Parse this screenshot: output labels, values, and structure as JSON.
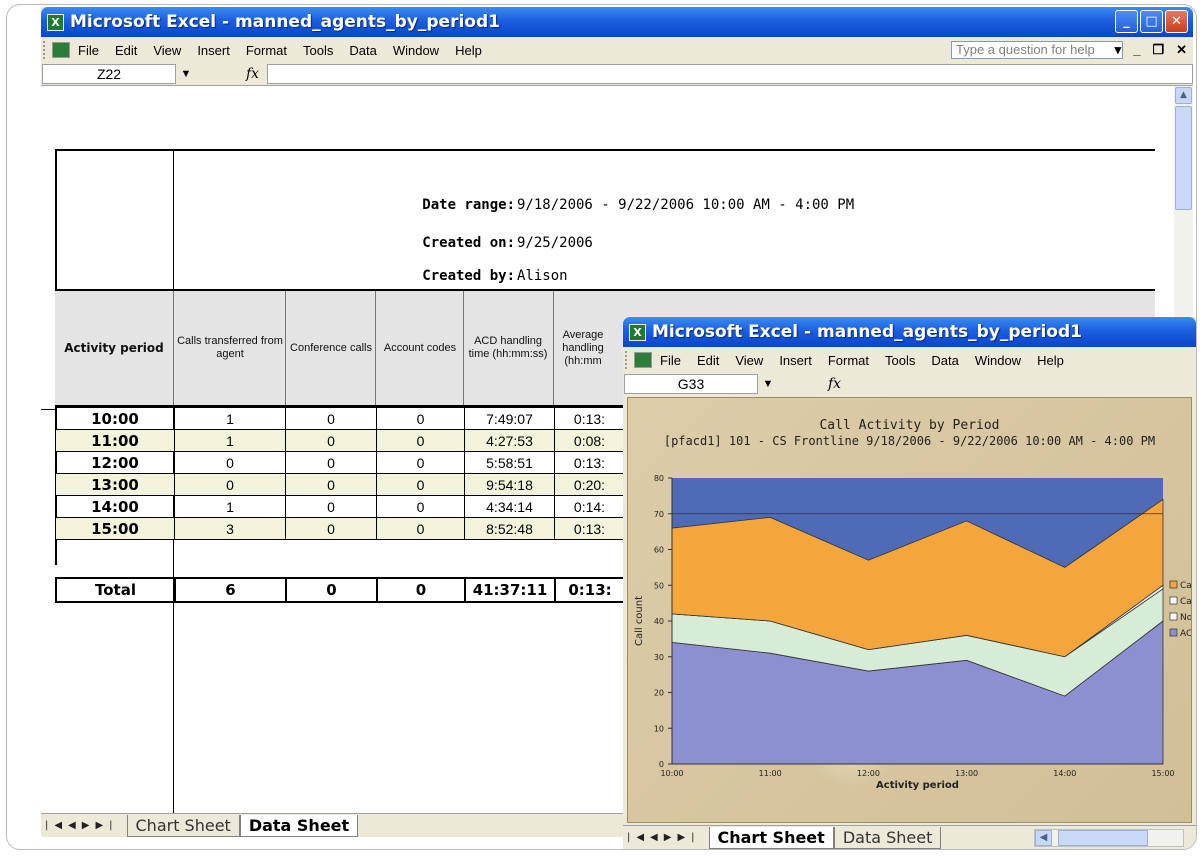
{
  "main_window": {
    "title": "Microsoft Excel - manned_agents_by_period1",
    "menu": [
      "File",
      "Edit",
      "View",
      "Insert",
      "Format",
      "Tools",
      "Data",
      "Window",
      "Help"
    ],
    "help_placeholder": "Type a question for help",
    "name_box": "Z22",
    "fx_label": "fx",
    "tabs": [
      "Chart Sheet",
      "Data Sheet"
    ],
    "active_tab": "Data Sheet"
  },
  "report": {
    "date_range_label": "Date range:",
    "date_range_value": "9/18/2006 - 9/22/2006 10:00 AM - 4:00 PM",
    "created_on_label": "Created on:",
    "created_on_value": "9/25/2006",
    "created_by_label": "Created by:",
    "created_by_value": "Alison",
    "columns": [
      "Activity period",
      "Calls transferred from agent",
      "Conference calls",
      "Account codes",
      "ACD handling time (hh:mm:ss)",
      "Average handling (hh:mm"
    ],
    "rows": [
      {
        "period": "10:00",
        "transferred": "1",
        "conference": "0",
        "account": "0",
        "acd_time": "7:49:07",
        "avg": "0:13:"
      },
      {
        "period": "11:00",
        "transferred": "1",
        "conference": "0",
        "account": "0",
        "acd_time": "4:27:53",
        "avg": "0:08:"
      },
      {
        "period": "12:00",
        "transferred": "0",
        "conference": "0",
        "account": "0",
        "acd_time": "5:58:51",
        "avg": "0:13:"
      },
      {
        "period": "13:00",
        "transferred": "0",
        "conference": "0",
        "account": "0",
        "acd_time": "9:54:18",
        "avg": "0:20:"
      },
      {
        "period": "14:00",
        "transferred": "1",
        "conference": "0",
        "account": "0",
        "acd_time": "4:34:14",
        "avg": "0:14:"
      },
      {
        "period": "15:00",
        "transferred": "3",
        "conference": "0",
        "account": "0",
        "acd_time": "8:52:48",
        "avg": "0:13:"
      }
    ],
    "total": {
      "label": "Total",
      "transferred": "6",
      "conference": "0",
      "account": "0",
      "acd_time": "41:37:11",
      "avg": "0:13:"
    }
  },
  "chart_window": {
    "title": "Microsoft Excel - manned_agents_by_period1",
    "menu": [
      "File",
      "Edit",
      "View",
      "Insert",
      "Format",
      "Tools",
      "Data",
      "Window",
      "Help"
    ],
    "name_box": "G33",
    "fx_label": "fx",
    "tabs": [
      "Chart Sheet",
      "Data Sheet"
    ],
    "active_tab": "Chart Sheet"
  },
  "chart_data": {
    "type": "area",
    "title": "Call Activity by Period",
    "subtitle": "[pfacd1] 101 - CS Frontline 9/18/2006 - 9/22/2006 10:00 AM - 4:00 PM",
    "xlabel": "Activity period",
    "ylabel": "Call count",
    "categories": [
      "10:00",
      "11:00",
      "12:00",
      "13:00",
      "14:00",
      "15:00"
    ],
    "ylim": [
      0,
      80
    ],
    "yticks": [
      0,
      10,
      20,
      30,
      40,
      50,
      60,
      70,
      80
    ],
    "stacked": true,
    "series": [
      {
        "name": "ACD",
        "values": [
          34,
          31,
          26,
          29,
          19,
          40
        ],
        "color": "#8c8fd0"
      },
      {
        "name": "Non",
        "values": [
          8,
          9,
          6,
          7,
          11,
          9
        ],
        "color": "#d6ecd6"
      },
      {
        "name": "Call",
        "values": [
          0,
          0,
          0,
          0,
          0,
          1
        ],
        "color": "#f5f5f5"
      },
      {
        "name": "Call",
        "values": [
          24,
          29,
          25,
          32,
          25,
          24
        ],
        "color": "#f4a63c"
      }
    ],
    "plot_background": "#4f6bb5",
    "legend_labels": [
      "Call",
      "Call",
      "Non",
      "ACD"
    ],
    "legend_colors": [
      "#f4a63c",
      "#ffffff",
      "#ffffff",
      "#8c8fd0"
    ]
  }
}
